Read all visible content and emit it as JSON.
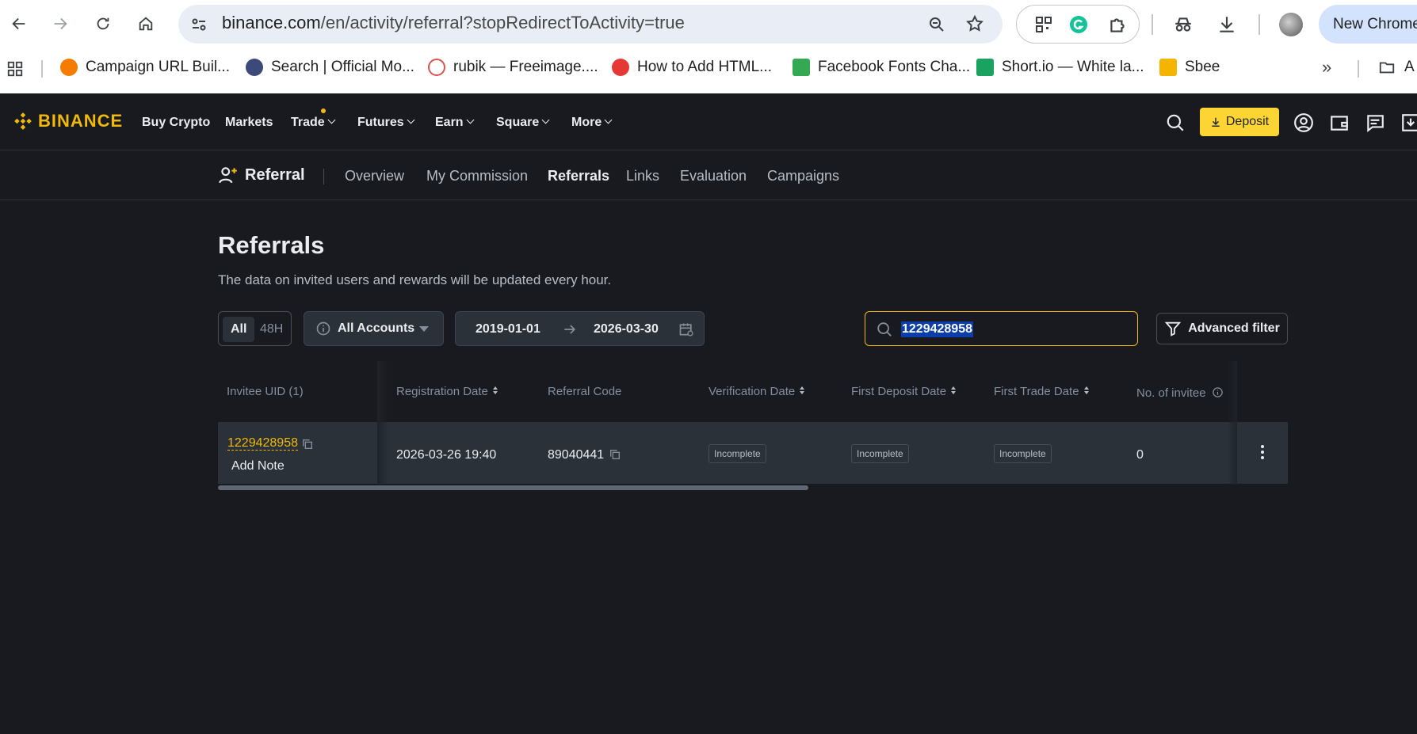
{
  "browser": {
    "url_domain": "binance.com",
    "url_path": "/en/activity/referral?stopRedirectToActivity=true",
    "profile_button": "New Chrome",
    "bookmarks": [
      {
        "label": "Campaign URL Buil...",
        "color": "#f57c00"
      },
      {
        "label": "Search | Official Mo...",
        "color": "#3c4a7a"
      },
      {
        "label": "rubik — Freeimage....",
        "color": "#d9534f"
      },
      {
        "label": "How to Add HTML...",
        "color": "#e53935"
      },
      {
        "label": "Facebook Fonts Cha...",
        "color": "#34a853"
      },
      {
        "label": "Short.io — White la...",
        "color": "#1aa260"
      },
      {
        "label": "Sbee",
        "color": "#f4b400"
      },
      {
        "label": "A",
        "color": "#5f6368"
      }
    ]
  },
  "header": {
    "logo": "BINANCE",
    "nav": [
      "Buy Crypto",
      "Markets",
      "Trade",
      "Futures",
      "Earn",
      "Square",
      "More"
    ],
    "deposit_label": "Deposit",
    "accent": "#f0b90b"
  },
  "subnav": {
    "title": "Referral",
    "tabs": [
      "Overview",
      "My Commission",
      "Referrals",
      "Links",
      "Evaluation",
      "Campaigns"
    ],
    "active_tab": "Referrals"
  },
  "page": {
    "title": "Referrals",
    "subtitle": "The data on invited users and rewards will be updated every hour."
  },
  "filters": {
    "range_options": [
      "All",
      "48H"
    ],
    "range_selected": "All",
    "accounts_label": "All Accounts",
    "date_start": "2019-01-01",
    "date_end": "2026-03-30",
    "search_value": "1229428958",
    "advanced_filter_label": "Advanced filter"
  },
  "table": {
    "columns": [
      "Invitee UID (1)",
      "Registration Date",
      "Referral Code",
      "Verification Date",
      "First Deposit Date",
      "First Trade Date",
      "No. of invitee"
    ],
    "rows": [
      {
        "uid": "1229428958",
        "add_note": "Add Note",
        "registration_date": "2026-03-26 19:40",
        "referral_code": "89040441",
        "verification": "Incomplete",
        "first_deposit": "Incomplete",
        "first_trade": "Incomplete",
        "invitees": "0"
      }
    ]
  }
}
